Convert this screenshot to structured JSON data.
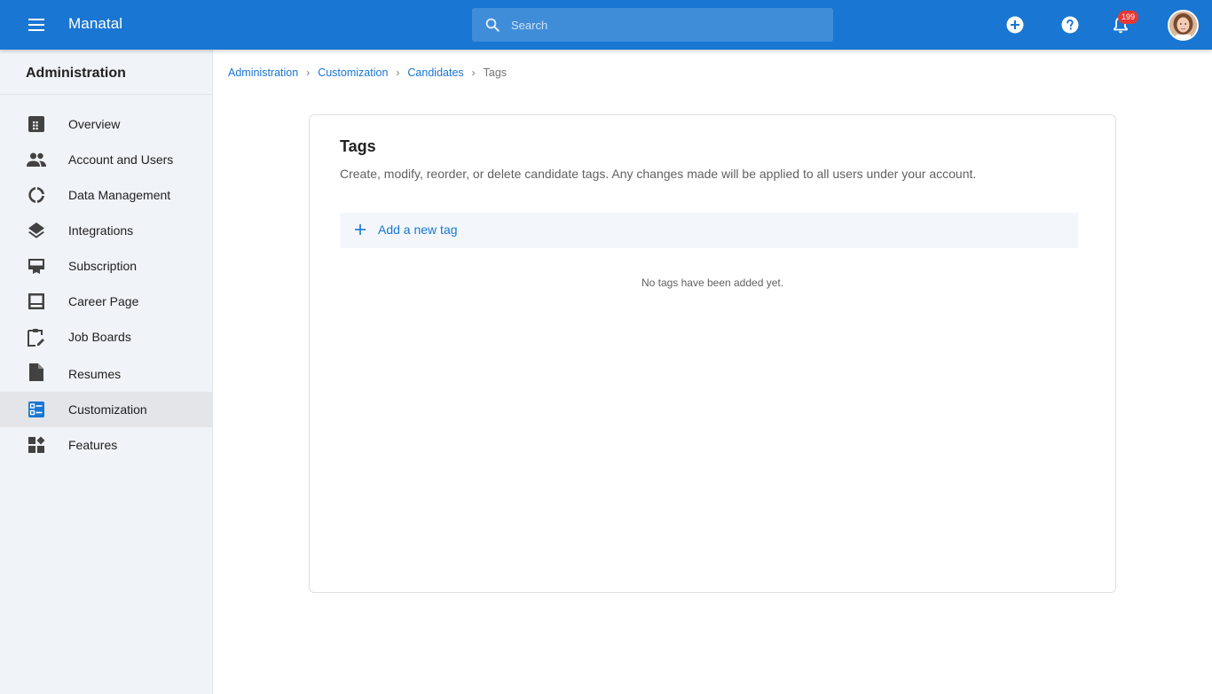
{
  "app": {
    "title": "Manatal"
  },
  "search": {
    "placeholder": "Search"
  },
  "topbar": {
    "notifications_count": "199",
    "icons": [
      "menu-icon",
      "add-circle-icon",
      "help-icon",
      "bell-icon",
      "avatar"
    ]
  },
  "sidebar": {
    "title": "Administration",
    "items": [
      {
        "label": "Overview",
        "icon": "dashboard-icon"
      },
      {
        "label": "Account and Users",
        "icon": "people-icon"
      },
      {
        "label": "Data Management",
        "icon": "donut-icon"
      },
      {
        "label": "Integrations",
        "icon": "layers-icon"
      },
      {
        "label": "Subscription",
        "icon": "card-membership-icon"
      },
      {
        "label": "Career Page",
        "icon": "web-page-icon"
      },
      {
        "label": "Job Boards",
        "icon": "clipboard-edit-icon"
      },
      {
        "label": "Resumes",
        "icon": "file-icon"
      },
      {
        "label": "Customization",
        "icon": "customize-list-icon",
        "active": true
      },
      {
        "label": "Features",
        "icon": "widgets-icon"
      }
    ]
  },
  "breadcrumb": {
    "items": [
      "Administration",
      "Customization",
      "Candidates"
    ],
    "current": "Tags"
  },
  "card": {
    "title": "Tags",
    "description": "Create, modify, reorder, or delete candidate tags. Any changes made will be applied to all users under your account.",
    "add_label": "Add a new tag",
    "empty_message": "No tags have been added yet."
  },
  "colors": {
    "primary": "#1976d2",
    "sidebar_bg": "#f0f3f7",
    "badge": "#e53935",
    "add_row_bg": "#f3f7fb"
  }
}
